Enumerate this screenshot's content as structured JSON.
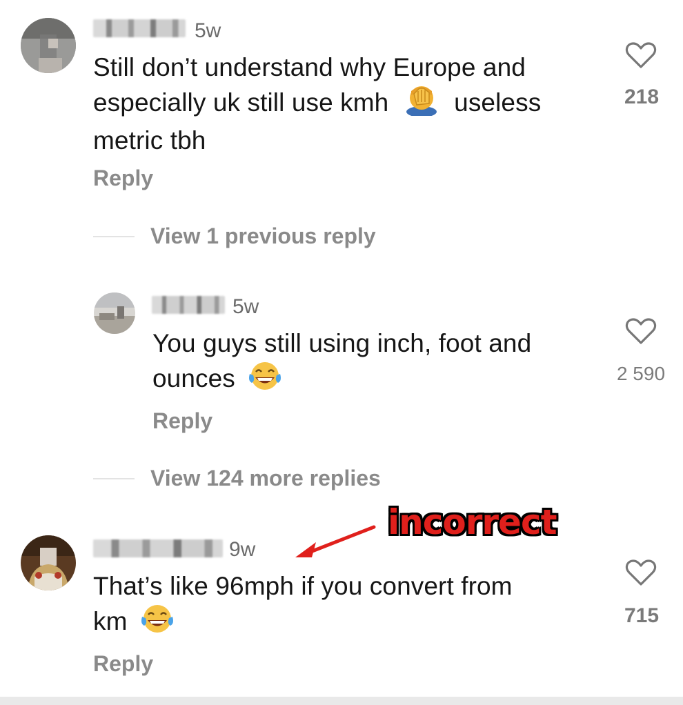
{
  "comments": [
    {
      "time": "5w",
      "text": "Still don’t understand why Europe and",
      "text_line2_a": "especially uk still use kmh",
      "text_line2_b": "useless",
      "text_line3": "metric tbh",
      "emoji": "face-palm-emoji",
      "reply_label": "Reply",
      "likes": "218"
    },
    {
      "view_previous": "View 1 previous reply"
    },
    {
      "time": "5w",
      "text_line1": "You guys still using inch, foot and",
      "text_line2": "ounces",
      "emoji": "tears-of-joy-emoji",
      "reply_label": "Reply",
      "likes": "2 590"
    },
    {
      "view_more": "View 124 more replies"
    },
    {
      "time": "9w",
      "text_line1": "That’s like 96mph if you convert from",
      "text_line2": "km",
      "emoji": "tears-of-joy-emoji",
      "reply_label": "Reply",
      "likes": "715"
    }
  ],
  "annotation": {
    "label": "incorrect",
    "color": "#e0201c"
  },
  "icons": {
    "like": "heart-icon"
  }
}
